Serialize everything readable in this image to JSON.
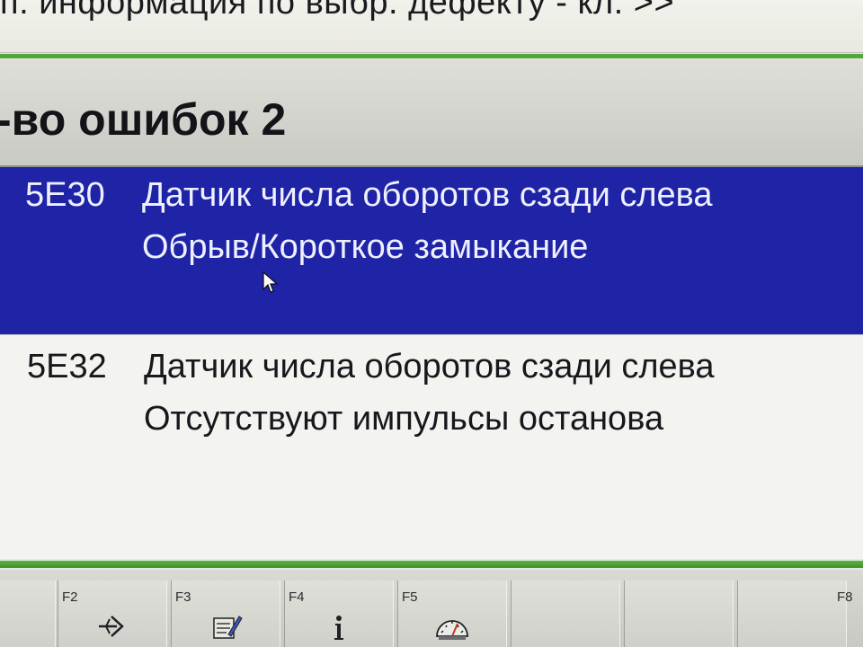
{
  "top_bar": {
    "info_text": "п. информация по выбр. дефекту - кл. >>"
  },
  "header": {
    "fault_count_text": "-во ошибок 2"
  },
  "faults": [
    {
      "code": "5E30",
      "line1": "Датчик числа оборотов сзади слева",
      "line2": "Обрыв/Короткое замыкание"
    },
    {
      "code": "5E32",
      "line1": "Датчик числа оборотов сзади слева",
      "line2": "Отсутствуют импульсы останова"
    }
  ],
  "function_keys": [
    {
      "label": "",
      "icon": ""
    },
    {
      "label": "F2",
      "icon": "next-arrow-icon"
    },
    {
      "label": "F3",
      "icon": "edit-note-icon"
    },
    {
      "label": "F4",
      "icon": "info-icon"
    },
    {
      "label": "F5",
      "icon": "gauge-icon"
    },
    {
      "label": "",
      "icon": ""
    },
    {
      "label": "",
      "icon": ""
    },
    {
      "label": "F8",
      "icon": ""
    }
  ],
  "colors": {
    "selected_row_bg": "#1f23a6",
    "accent_green": "#52a73a",
    "selected_text": "#eef0ff"
  }
}
